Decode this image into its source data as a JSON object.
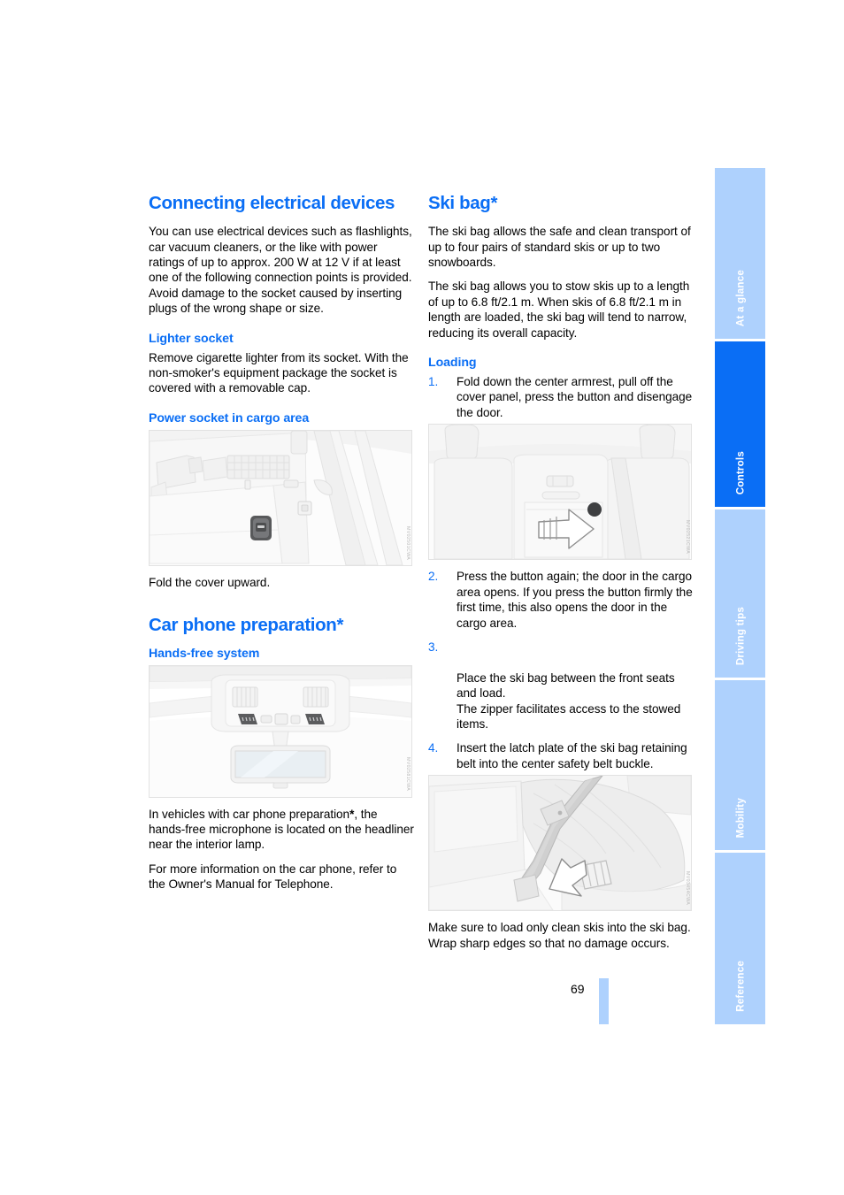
{
  "page": {
    "number": "69"
  },
  "left_column": {
    "section_title": "Connecting electrical devices",
    "intro": "You can use electrical devices such as flashlights, car vacuum cleaners, or the like with power ratings of up to approx. 200 W at 12 V if at least one of the following connection points is provided. Avoid damage to the socket caused by inserting plugs of the wrong shape or size.",
    "lighter_socket": {
      "heading": "Lighter socket",
      "text": "Remove cigarette lighter from its socket. With the non-smoker's equipment package the socket is covered with a removable cap."
    },
    "power_socket": {
      "heading": "Power socket in cargo area",
      "figure_name": "cargo-area-power-socket-illustration",
      "figure_code": "MV02501CWA",
      "caption": "Fold the cover upward."
    },
    "car_phone": {
      "section_title": "Car phone preparation*",
      "heading": "Hands-free system",
      "figure_name": "headliner-interior-mirror-illustration",
      "figure_code": "MV02581CWA",
      "paragraph_1_before_star": "In vehicles with car phone preparation",
      "paragraph_1_star": "*",
      "paragraph_1_after_star": ", the hands-free microphone is located on the headliner near the interior lamp.",
      "paragraph_2": "For more information on the car phone, refer to the Owner's Manual for Telephone."
    }
  },
  "right_column": {
    "section_title": "Ski bag*",
    "intro_1": "The ski bag allows the safe and clean transport of up to four pairs of standard skis or up to two snowboards.",
    "intro_2": "The ski bag allows you to stow skis up to a length of up to 6.8 ft/2.1 m. When skis of 6.8 ft/2.1 m in length are loaded, the ski bag will tend to narrow, reducing its overall capacity.",
    "loading": {
      "heading": "Loading",
      "steps": [
        {
          "num": "1.",
          "text": "Fold down the center armrest, pull off the cover panel, press the button and disengage the door."
        },
        {
          "num": "2.",
          "text": "Press the button again; the door in the cargo area opens. If you press the button firmly the first time, this also opens the door in the cargo area."
        },
        {
          "num": "3.",
          "text": "Place the ski bag between the front seats and load.\nThe zipper facilitates access to the stowed items."
        },
        {
          "num": "4.",
          "text": "Insert the latch plate of the ski bag retaining belt into the center safety belt buckle."
        }
      ]
    },
    "figure_seat_name": "rear-seat-armrest-button-illustration",
    "figure_seat_code": "MV02521CWA",
    "figure_skibag_name": "ski-bag-retaining-belt-illustration",
    "figure_skibag_code": "MV03454CWA",
    "closing": "Make sure to load only clean skis into the ski bag. Wrap sharp edges so that no damage occurs."
  },
  "tabs": [
    {
      "label": "At a glance",
      "active": false
    },
    {
      "label": "Controls",
      "active": true
    },
    {
      "label": "Driving tips",
      "active": false
    },
    {
      "label": "Mobility",
      "active": false
    },
    {
      "label": "Reference",
      "active": false
    }
  ],
  "colors": {
    "accent_blue": "#0a6ef5",
    "tab_inactive": "#aed1fd",
    "text": "#000000"
  }
}
